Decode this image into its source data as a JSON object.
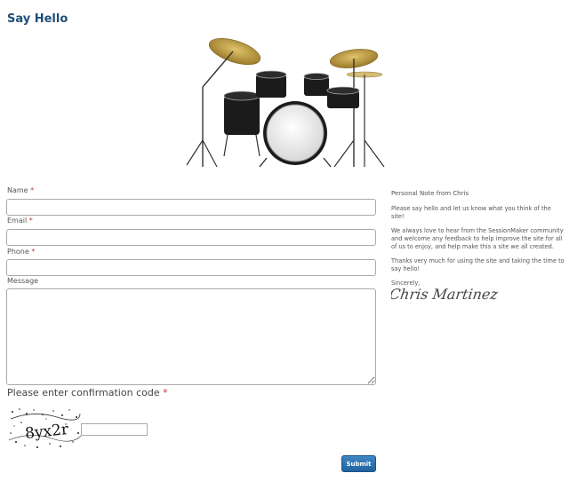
{
  "page": {
    "title": "Say Hello"
  },
  "form": {
    "name_label": "Name",
    "email_label": "Email",
    "phone_label": "Phone",
    "message_label": "Message",
    "required_mark": "*",
    "name_value": "",
    "email_value": "",
    "phone_value": "",
    "message_value": "",
    "confirm_label": "Please enter confirmation code",
    "captcha_text": "8yx2r",
    "captcha_value": "",
    "submit_label": "Submit"
  },
  "note": {
    "title": "Personal Note from Chris",
    "p1": "Please say hello and let us know what you think of the site!",
    "p2": "We always love to hear from the SessionMaker community and welcome any feedback to help improve the site for all of us to enjoy, and help make this a site we all created.",
    "p3": "Thanks very much for using the site and taking the time to say hello!",
    "closing": "Sincerely,",
    "signature": "Chris Martinez"
  },
  "colors": {
    "title": "#1f4e79",
    "required": "#c0392b",
    "button": "#2a6db0",
    "cymbal": "#c9a646"
  },
  "icons": {
    "hero": "drum-kit-image",
    "captcha": "captcha-image",
    "signature": "signature-image"
  }
}
